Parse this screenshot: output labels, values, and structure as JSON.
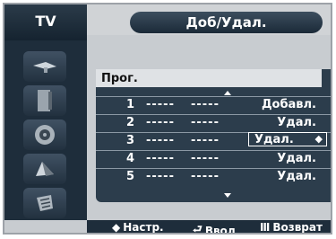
{
  "header": {
    "tv_label": "TV",
    "title": "Доб/Удал."
  },
  "nav": {
    "items": [
      {
        "icon": "antenna-icon"
      },
      {
        "icon": "picture-icon"
      },
      {
        "icon": "speaker-icon"
      },
      {
        "icon": "channel-icon"
      },
      {
        "icon": "setup-icon"
      }
    ]
  },
  "list": {
    "header": "Прог.",
    "rows": [
      {
        "num": "1",
        "d1": "-----",
        "d2": "-----",
        "status": "Добавл."
      },
      {
        "num": "2",
        "d1": "-----",
        "d2": "-----",
        "status": "Удал."
      },
      {
        "num": "3",
        "d1": "-----",
        "d2": "-----",
        "status": "Удал.",
        "updown": "◆"
      },
      {
        "num": "4",
        "d1": "-----",
        "d2": "-----",
        "status": "Удал."
      },
      {
        "num": "5",
        "d1": "-----",
        "d2": "-----",
        "status": "Удал."
      }
    ]
  },
  "footer": {
    "adjust_icon": "◆",
    "adjust_label": "Настр.",
    "enter_icon": "⮐",
    "enter_label": "Ввод",
    "return_icon": "Ⅲ",
    "return_label": "Возврат"
  }
}
